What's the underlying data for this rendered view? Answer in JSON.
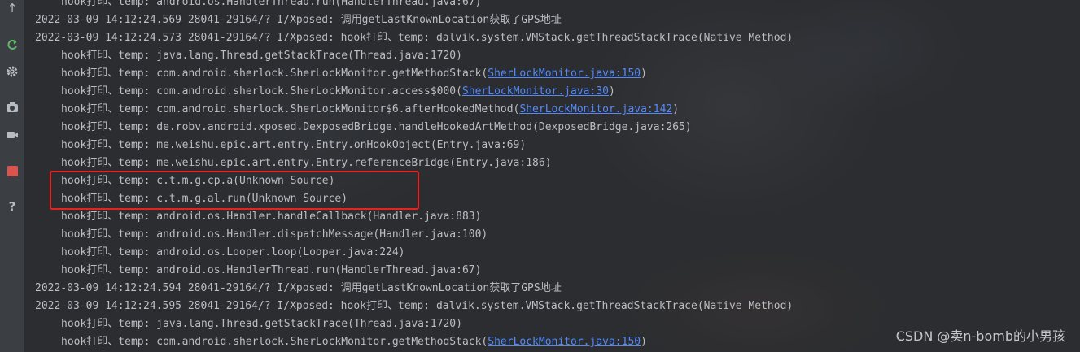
{
  "gutter": {
    "icons": [
      "up-arrow-icon",
      "rerun-icon",
      "settings-icon",
      "camera-icon",
      "video-icon",
      "stop-icon",
      "help-icon"
    ]
  },
  "log_lines": [
    {
      "kind": "indent",
      "text": "hook打印、temp: android.os.HandlerThread.run(HandlerThread.java:67)"
    },
    {
      "kind": "ts",
      "text": "2022-03-09 14:12:24.569 28041-29164/? I/Xposed: 调用getLastKnownLocation获取了GPS地址"
    },
    {
      "kind": "ts",
      "text": "2022-03-09 14:12:24.573 28041-29164/? I/Xposed: hook打印、temp: dalvik.system.VMStack.getThreadStackTrace(Native Method)"
    },
    {
      "kind": "indent",
      "text": "hook打印、temp: java.lang.Thread.getStackTrace(Thread.java:1720)"
    },
    {
      "kind": "indent",
      "pre": "hook打印、temp: com.android.sherlock.SherLockMonitor.getMethodStack(",
      "link": "SherLockMonitor.java:150",
      "post": ")"
    },
    {
      "kind": "indent",
      "pre": "hook打印、temp: com.android.sherlock.SherLockMonitor.access$000(",
      "link": "SherLockMonitor.java:30",
      "post": ")"
    },
    {
      "kind": "indent",
      "pre": "hook打印、temp: com.android.sherlock.SherLockMonitor$6.afterHookedMethod(",
      "link": "SherLockMonitor.java:142",
      "post": ")"
    },
    {
      "kind": "indent",
      "text": "hook打印、temp: de.robv.android.xposed.DexposedBridge.handleHookedArtMethod(DexposedBridge.java:265)"
    },
    {
      "kind": "indent",
      "text": "hook打印、temp: me.weishu.epic.art.entry.Entry.onHookObject(Entry.java:69)"
    },
    {
      "kind": "indent",
      "text": "hook打印、temp: me.weishu.epic.art.entry.Entry.referenceBridge(Entry.java:186)"
    },
    {
      "kind": "indent",
      "text": "hook打印、temp: c.t.m.g.cp.a(Unknown Source)"
    },
    {
      "kind": "indent",
      "text": "hook打印、temp: c.t.m.g.al.run(Unknown Source)"
    },
    {
      "kind": "indent",
      "text": "hook打印、temp: android.os.Handler.handleCallback(Handler.java:883)"
    },
    {
      "kind": "indent",
      "text": "hook打印、temp: android.os.Handler.dispatchMessage(Handler.java:100)"
    },
    {
      "kind": "indent",
      "text": "hook打印、temp: android.os.Looper.loop(Looper.java:224)"
    },
    {
      "kind": "indent",
      "text": "hook打印、temp: android.os.HandlerThread.run(HandlerThread.java:67)"
    },
    {
      "kind": "ts",
      "text": "2022-03-09 14:12:24.594 28041-29164/? I/Xposed: 调用getLastKnownLocation获取了GPS地址"
    },
    {
      "kind": "ts",
      "text": "2022-03-09 14:12:24.595 28041-29164/? I/Xposed: hook打印、temp: dalvik.system.VMStack.getThreadStackTrace(Native Method)"
    },
    {
      "kind": "indent",
      "text": "hook打印、temp: java.lang.Thread.getStackTrace(Thread.java:1720)"
    },
    {
      "kind": "indent",
      "pre": "hook打印、temp: com.android.sherlock.SherLockMonitor.getMethodStack(",
      "link": "SherLockMonitor.java:150",
      "post": ")"
    }
  ],
  "watermark": "CSDN @卖n-bomb的小男孩",
  "colors": {
    "text": "#bcbec4",
    "link": "#548af7",
    "highlight_border": "#e8231f",
    "background": "#2b2d30"
  }
}
